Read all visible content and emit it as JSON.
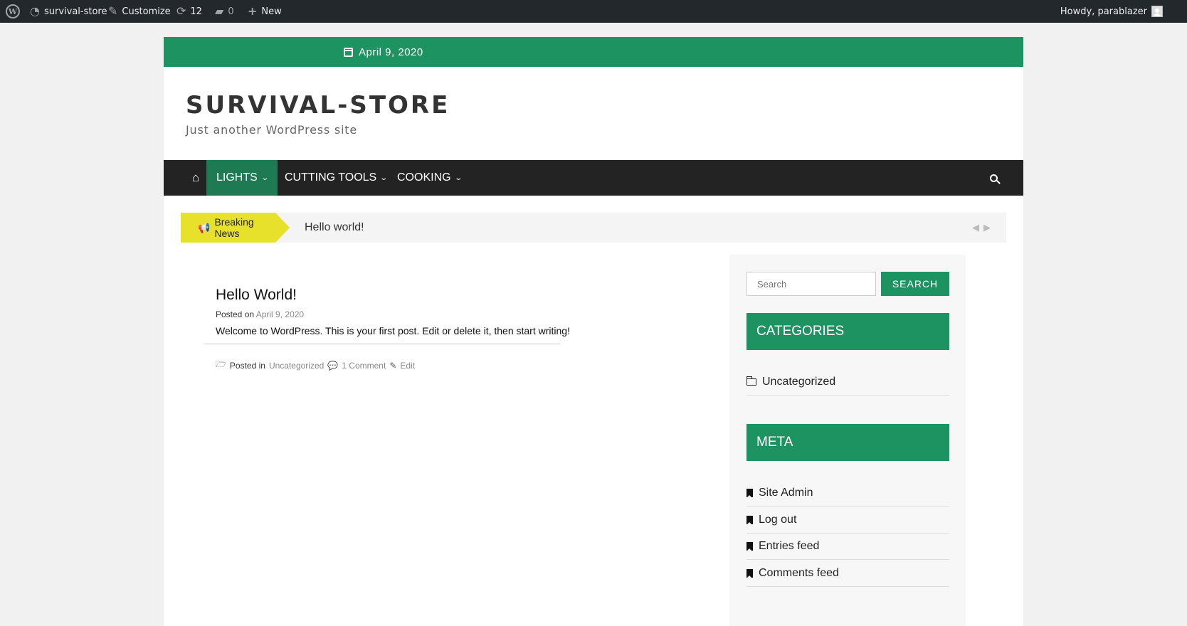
{
  "admin_bar": {
    "site_name": "survival-store",
    "customize": "Customize",
    "updates_count": "12",
    "comments_count": "0",
    "new": "New",
    "howdy": "Howdy, parablazer"
  },
  "header": {
    "date": "April 9, 2020",
    "site_title": "SURVIVAL-STORE",
    "tagline": "Just another WordPress site"
  },
  "nav": {
    "items": [
      {
        "label": "LIGHTS"
      },
      {
        "label": "CUTTING TOOLS"
      },
      {
        "label": "COOKING"
      }
    ]
  },
  "ticker": {
    "label": "Breaking News",
    "headline": "Hello world!"
  },
  "post": {
    "title": "Hello World!",
    "posted_on": "Posted on",
    "date": "April 9, 2020",
    "body": "Welcome to WordPress. This is your first post. Edit or delete it, then start writing!",
    "posted_in": "Posted in",
    "category": "Uncategorized",
    "comments": "1 Comment",
    "edit": "Edit"
  },
  "sidebar": {
    "search_placeholder": "Search",
    "search_button": "SEARCH",
    "categories_title": "CATEGORIES",
    "categories": [
      "Uncategorized"
    ],
    "meta_title": "META",
    "meta_links": [
      "Site Admin",
      "Log out",
      "Entries feed",
      "Comments feed"
    ]
  },
  "colors": {
    "accent": "#1e9362",
    "nav_bg": "#232323",
    "admin_bar_bg": "#23282d",
    "breaking_bg": "#e7e12b"
  }
}
